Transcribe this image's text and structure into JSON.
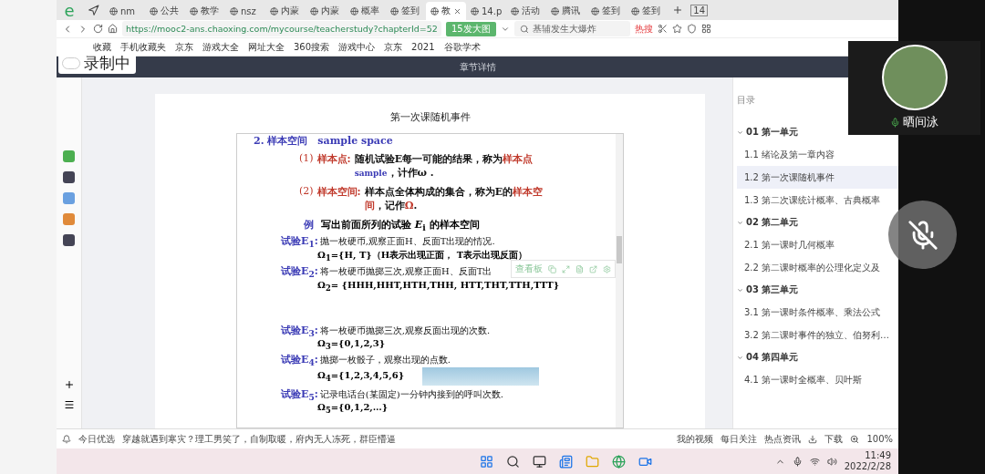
{
  "browser_logo": "e",
  "recording": {
    "label": "录制中"
  },
  "tabs": [
    {
      "label": "nm",
      "selected": false
    },
    {
      "label": "公共",
      "selected": false
    },
    {
      "label": "教学",
      "selected": false
    },
    {
      "label": "nsz",
      "selected": false
    },
    {
      "label": "内蒙",
      "selected": false
    },
    {
      "label": "内蒙",
      "selected": false
    },
    {
      "label": "概率",
      "selected": false
    },
    {
      "label": "签到",
      "selected": false
    },
    {
      "label": "教",
      "selected": true
    },
    {
      "label": "14.p",
      "selected": false
    },
    {
      "label": "活动",
      "selected": false
    },
    {
      "label": "腾讯",
      "selected": false
    },
    {
      "label": "签到",
      "selected": false
    },
    {
      "label": "签到",
      "selected": false
    }
  ],
  "tab_count": "14",
  "address": {
    "url": "https://mooc2-ans.chaoxing.com/mycourse/teacherstudy?chapterId=52",
    "badge": "15发大图",
    "search_placeholder": "基辅发生大爆炸",
    "hot": "热搜"
  },
  "bookmarks": [
    "收藏",
    "手机收藏夹",
    "京东",
    "游戏大全",
    "网址大全",
    "360搜索",
    "游戏中心",
    "京东",
    "2021",
    "谷歌学术"
  ],
  "page_header": "章节详情",
  "card_title": "第一次课随机事件",
  "slide": {
    "heading": "2. 样本空间　sample space",
    "definitions": [
      {
        "number": "(1)",
        "term": "样本点:",
        "segments": [
          {
            "kind": "plain",
            "text": "随机试验E每一可能的结果，称为"
          },
          {
            "kind": "term",
            "text": "样本点"
          },
          {
            "kind": "small",
            "text": "sample"
          },
          {
            "kind": "plain",
            "text": "，计作ω ."
          }
        ]
      },
      {
        "number": "(2)",
        "term": "样本空间:",
        "segments": [
          {
            "kind": "plain",
            "text": "样本点全体构成的集合，称为E的"
          },
          {
            "kind": "term",
            "text": "样本空间"
          },
          {
            "kind": "plain",
            "text": "，记作"
          },
          {
            "kind": "term",
            "text": "Ω"
          },
          {
            "kind": "plain",
            "text": "."
          }
        ]
      }
    ],
    "example": {
      "label": "例",
      "text": "写出前面所列的试验 *E*$_{i}$ 的样本空间"
    },
    "trials": [
      {
        "kind": "plain",
        "label": "试验E$_{1}$:",
        "description": "抛一枚硬币,观察正面H、反面T出现的情况.",
        "result": "Ω$_{1}$={H, T}（H表示出现正面， T表示出现反面）"
      },
      {
        "kind": "plain",
        "label": "试验E$_{2}$:",
        "description": "将一枚硬币抛掷三次,观察正面H、反面T出",
        "result": "Ω$_{2}$= {HHH,HHT,HTH,THH, HTT,THT,TTH,TTT}"
      },
      {
        "kind": "spaced",
        "label": "试验E$_{3}$:",
        "description": "将一枚硬币抛掷三次,观察反面出现的次数.",
        "result": "Ω$_{3}$={0,1,2,3}"
      },
      {
        "kind": "dice",
        "label": "试验E$_{4}$:",
        "description": "抛掷一枚骰子，观察出现的点数.",
        "result": "Ω$_{4}$={1,2,3,4,5,6}"
      },
      {
        "kind": "plain",
        "label": "试验E$_{5}$:",
        "description": "记录电话台(某固定)一分钟内接到的呼叫次数.",
        "result": "Ω$_{5}$={0,1,2,…}"
      }
    ],
    "toolbar_label": "查看板"
  },
  "toc": {
    "title": "目录",
    "units": [
      {
        "label": "01 第一单元",
        "children": [
          {
            "label": "1.1 绪论及第一章内容",
            "selected": false
          },
          {
            "label": "1.2 第一次课随机事件",
            "selected": true
          },
          {
            "label": "1.3 第二次课统计概率、古典概率",
            "selected": false
          }
        ]
      },
      {
        "label": "02 第二单元",
        "children": [
          {
            "label": "2.1 第一课时几何概率",
            "selected": false
          },
          {
            "label": "2.2 第二课时概率的公理化定义及",
            "selected": false
          }
        ]
      },
      {
        "label": "03 第三单元",
        "children": [
          {
            "label": "3.1 第一课时条件概率、乘法公式",
            "selected": false
          },
          {
            "label": "3.2 第二课时事件的独立、伯努利…",
            "selected": false
          }
        ]
      },
      {
        "label": "04 第四单元",
        "children": [
          {
            "label": "4.1 第一课时全概率、贝叶斯",
            "selected": false
          }
        ]
      }
    ]
  },
  "webcam": {
    "name": "晒间泳"
  },
  "status_bar": {
    "left": "今日优选",
    "news": "穿越就遇到寒灾？理工男笑了，自制取暖，府内无人冻死，群臣懵逼",
    "items": [
      "我的视频",
      "每日关注",
      "热点资讯"
    ],
    "download": "下载",
    "zoom": "100%"
  },
  "taskbar": {
    "time": "11:49",
    "date": "2022/2/28"
  }
}
